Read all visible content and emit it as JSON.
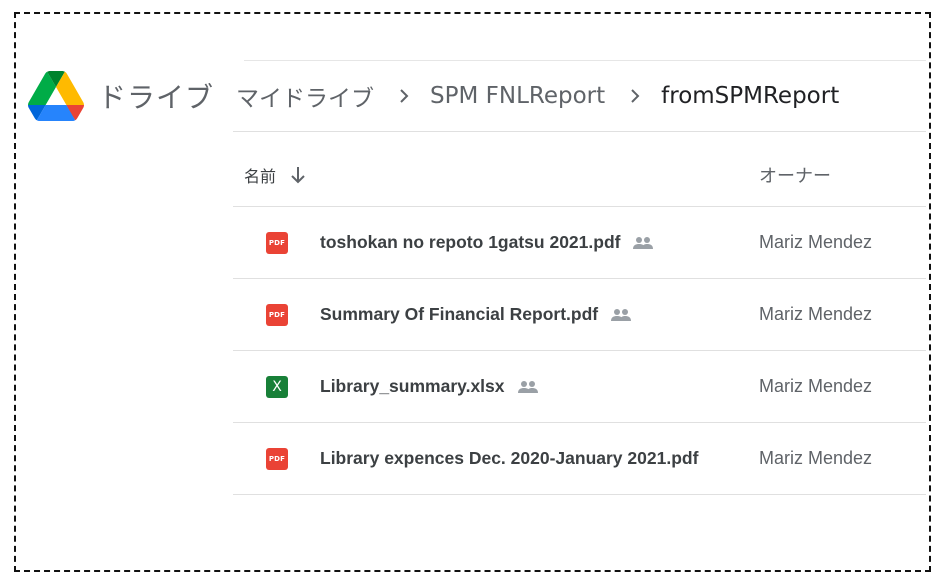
{
  "header": {
    "brand": "ドライブ",
    "breadcrumbs": [
      "マイドライブ",
      "SPM FNLReport",
      "fromSPMReport"
    ]
  },
  "columns": {
    "name": "名前",
    "owner": "オーナー"
  },
  "files": [
    {
      "name": "toshokan no repoto 1gatsu 2021.pdf",
      "type": "pdf",
      "icon_text": "PDF",
      "owner": "Mariz Mendez",
      "shared": true
    },
    {
      "name": "Summary Of Financial Report.pdf",
      "type": "pdf",
      "icon_text": "PDF",
      "owner": "Mariz Mendez",
      "shared": true
    },
    {
      "name": "Library_summary.xlsx",
      "type": "xlsx",
      "icon_text": "X",
      "owner": "Mariz Mendez",
      "shared": true
    },
    {
      "name": "Library expences Dec. 2020-January 2021.pdf",
      "type": "pdf",
      "icon_text": "PDF",
      "owner": "Mariz Mendez",
      "shared": false
    }
  ],
  "icons": {
    "logo": "google-drive-logo",
    "chevron": "chevron-right-icon",
    "sort": "arrow-down-icon",
    "shared": "people-icon"
  },
  "colors": {
    "pdf": "#ea4335",
    "xlsx": "#188038",
    "drive_green": "#0f9d58",
    "drive_yellow": "#fbbc04",
    "drive_blue": "#4285f4"
  }
}
